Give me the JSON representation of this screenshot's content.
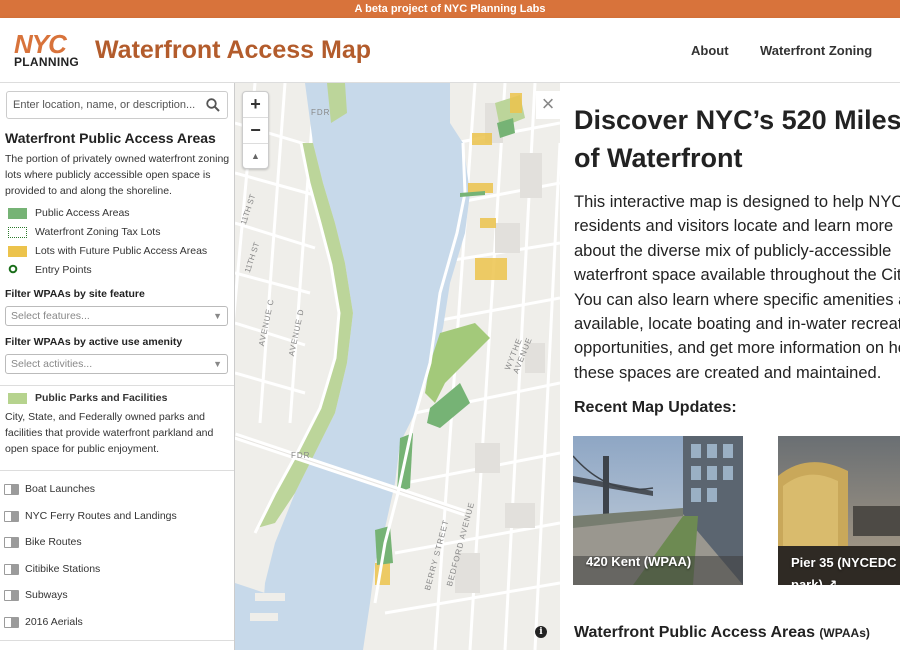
{
  "banner": {
    "text": "A beta project of NYC Planning Labs"
  },
  "header": {
    "logo_top": "NYC",
    "logo_bottom": "PLANNING",
    "title": "Waterfront Access Map",
    "nav": [
      {
        "label": "About"
      },
      {
        "label": "Waterfront Zoning"
      }
    ]
  },
  "sidebar": {
    "search": {
      "placeholder": "Enter location, name, or description..."
    },
    "wpaa": {
      "title": "Waterfront Public Access Areas",
      "description": "The portion of privately owned waterfront zoning lots where publicly accessible open space is provided to and along the shoreline.",
      "legend": [
        {
          "label": "Public Access Areas",
          "color": "#76b375"
        },
        {
          "label": "Waterfront Zoning Tax Lots",
          "color": "#2c7a2c"
        },
        {
          "label": "Lots with Future Public Access Areas",
          "color": "#ecc34c"
        },
        {
          "label": "Entry Points",
          "color": "#1a6e1a"
        }
      ]
    },
    "filter_feature": {
      "label": "Filter WPAAs by site feature",
      "placeholder": "Select features..."
    },
    "filter_amenity": {
      "label": "Filter WPAAs by active use amenity",
      "placeholder": "Select activities..."
    },
    "parks": {
      "label": "Public Parks and Facilities",
      "color": "#b6d38e",
      "description": "City, State, and Federally owned parks and facilities that provide waterfront parkland and open space for public enjoyment."
    },
    "layers": [
      {
        "label": "Boat Launches"
      },
      {
        "label": "NYC Ferry Routes and Landings"
      },
      {
        "label": "Bike Routes"
      },
      {
        "label": "Citibike Stations"
      },
      {
        "label": "Subways"
      },
      {
        "label": "2016 Aerials"
      }
    ]
  },
  "map": {
    "zoom_in": "+",
    "zoom_out": "−",
    "compass": "▲",
    "info": "i",
    "street_labels": [
      "11TH ST",
      "11TH ST",
      "AVENUE C",
      "AVENUE D",
      "FDR",
      "FDR",
      "WYTHE AVENUE",
      "BERRY STREET",
      "BEDFORD AVENUE"
    ]
  },
  "content": {
    "close": "×",
    "title_line1": "Discover NYC’s 520 Miles",
    "title_line2": "of Waterfront",
    "intro_lines": [
      "This interactive map is designed to help NYC",
      "residents and visitors locate and learn more",
      "about the diverse mix of publicly-accessible",
      "waterfront space available throughout the City.",
      "You can also learn where specific amenities are",
      "available, locate boating and in-water recreation",
      "opportunities, and get more information on how",
      "these spaces are created and maintained."
    ],
    "recent_title": "Recent Map Updates:",
    "cards": [
      {
        "line1": "420 Kent (WPAA)",
        "line2": ""
      },
      {
        "line1": "Pier 35 (NYCEDC",
        "line2": "park) ↗"
      }
    ],
    "wpaa_heading": "Waterfront Public Access Areas",
    "wpaa_heading_suffix": "(WPAAs)"
  }
}
